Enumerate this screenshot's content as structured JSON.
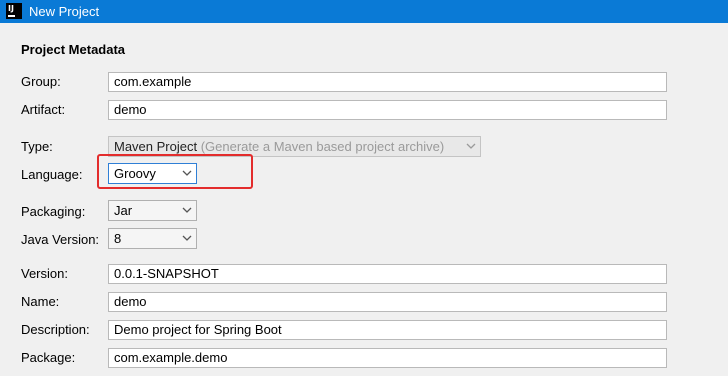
{
  "window": {
    "title": "New Project",
    "app_icon_text": "IJ"
  },
  "section": {
    "title": "Project Metadata"
  },
  "fields": {
    "group": {
      "label": "Group:",
      "value": "com.example"
    },
    "artifact": {
      "label": "Artifact:",
      "value": "demo"
    },
    "type": {
      "label": "Type:",
      "value": "Maven Project",
      "hint": "(Generate a Maven based project archive)"
    },
    "language": {
      "label": "Language:",
      "value": "Groovy"
    },
    "packaging": {
      "label": "Packaging:",
      "value": "Jar"
    },
    "java_version": {
      "label": "Java Version:",
      "value": "8"
    },
    "version": {
      "label": "Version:",
      "value": "0.0.1-SNAPSHOT"
    },
    "name": {
      "label": "Name:",
      "value": "demo"
    },
    "description": {
      "label": "Description:",
      "value": "Demo project for Spring Boot"
    },
    "package": {
      "label": "Package:",
      "value": "com.example.demo"
    }
  },
  "colors": {
    "titlebar": "#0a7ad6",
    "highlight": "#e32c2c"
  },
  "icons": {
    "app": "intellij-icon",
    "dropdown": "chevron-down-icon"
  }
}
